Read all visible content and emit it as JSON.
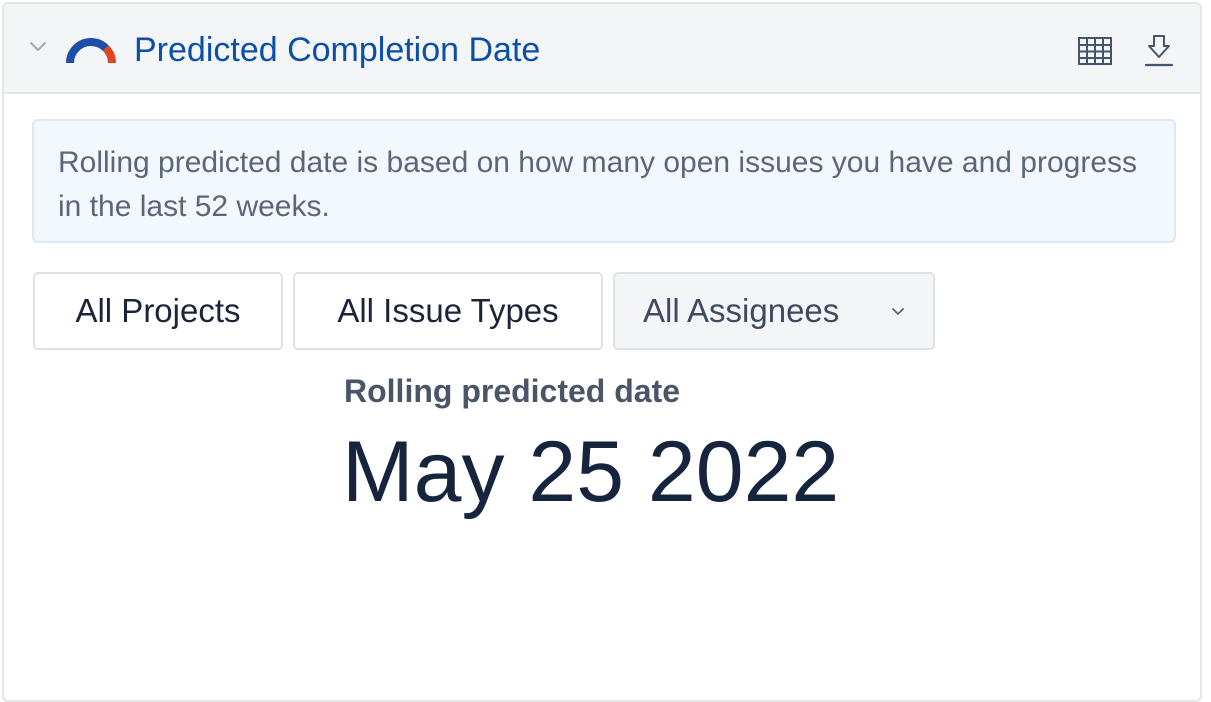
{
  "widget": {
    "title": "Predicted Completion Date",
    "collapse_icon": "chevron-down-icon",
    "logo_icon": "gauge-icon",
    "table_icon": "table-icon",
    "download_icon": "download-icon",
    "colors": {
      "title": "#0b4fa8",
      "logo_blue": "#1c4fa8",
      "logo_red": "#e0461f"
    }
  },
  "info": {
    "text": "Rolling predicted date is based on how many open issues you have and progress in the last 52 weeks."
  },
  "filters": {
    "projects": "All Projects",
    "issue_types": "All Issue Types",
    "assignees": "All Assignees"
  },
  "result": {
    "label": "Rolling predicted date",
    "date": "May 25 2022"
  }
}
